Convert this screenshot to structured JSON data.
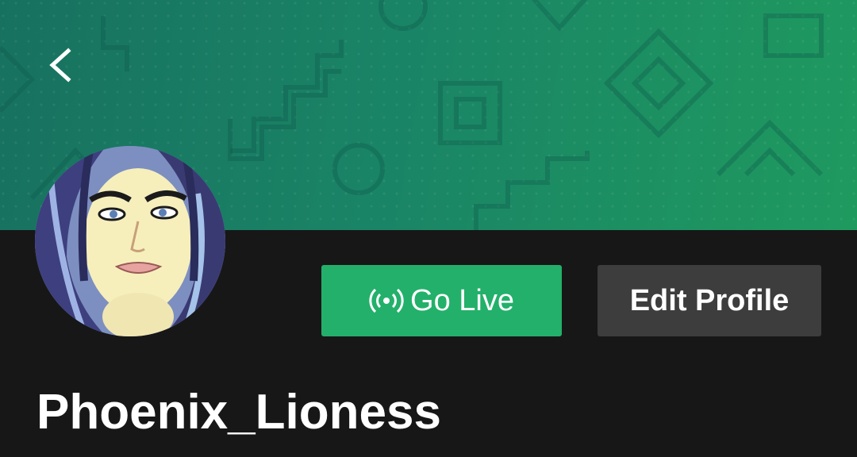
{
  "header": {
    "back_icon": "chevron-left-icon",
    "banner_colors": [
      "#17715f",
      "#1a8466",
      "#1f9a5f"
    ]
  },
  "profile": {
    "username": "Phoenix_Lioness",
    "avatar": "profile-photo"
  },
  "actions": {
    "go_live_label": "Go Live",
    "go_live_icon": "broadcast-icon",
    "go_live_color": "#23b06a",
    "edit_profile_label": "Edit Profile",
    "edit_profile_color": "#3d3d3d"
  },
  "theme": {
    "background": "#171717",
    "text": "#ffffff"
  }
}
